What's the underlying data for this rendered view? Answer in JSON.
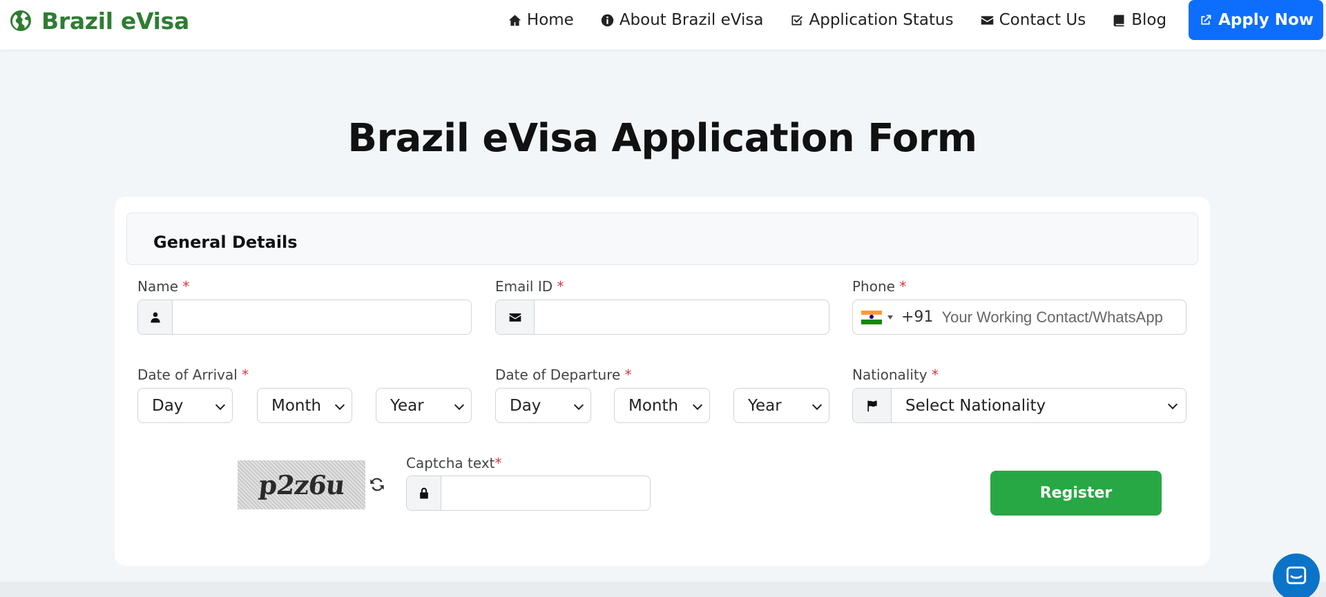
{
  "brand": {
    "name": "Brazil eVisa",
    "color": "#2e7d32"
  },
  "nav": {
    "items": [
      {
        "label": "Home",
        "icon": "home-icon"
      },
      {
        "label": "About Brazil eVisa",
        "icon": "info-circle-icon"
      },
      {
        "label": "Application Status",
        "icon": "check-square-icon"
      },
      {
        "label": "Contact Us",
        "icon": "envelope-icon"
      },
      {
        "label": "Blog",
        "icon": "book-icon"
      }
    ],
    "apply": {
      "label": "Apply Now",
      "icon": "external-link-icon",
      "color": "#0d6efd"
    }
  },
  "page": {
    "title": "Brazil eVisa Application Form"
  },
  "form": {
    "section_title": "General Details",
    "required_marker": "*",
    "name": {
      "label": "Name",
      "value": "",
      "icon": "user-icon"
    },
    "email": {
      "label": "Email ID",
      "value": "",
      "icon": "envelope-icon"
    },
    "phone": {
      "label": "Phone",
      "flag": "india-flag-icon",
      "dial_code": "+91",
      "placeholder": "Your Working Contact/WhatsApp",
      "value": ""
    },
    "arrival": {
      "label": "Date of Arrival",
      "day": "Day",
      "month": "Month",
      "year": "Year"
    },
    "departure": {
      "label": "Date of Departure",
      "day": "Day",
      "month": "Month",
      "year": "Year"
    },
    "nationality": {
      "label": "Nationality",
      "selected": "Select Nationality",
      "icon": "flag-icon"
    },
    "captcha": {
      "image_text": "p2z6u",
      "label": "Captcha text",
      "value": "",
      "icon": "lock-icon"
    },
    "register_label": "Register",
    "register_color": "#28a745"
  },
  "chat": {
    "icon": "chat-bubble-icon",
    "color": "#0b73c8"
  }
}
